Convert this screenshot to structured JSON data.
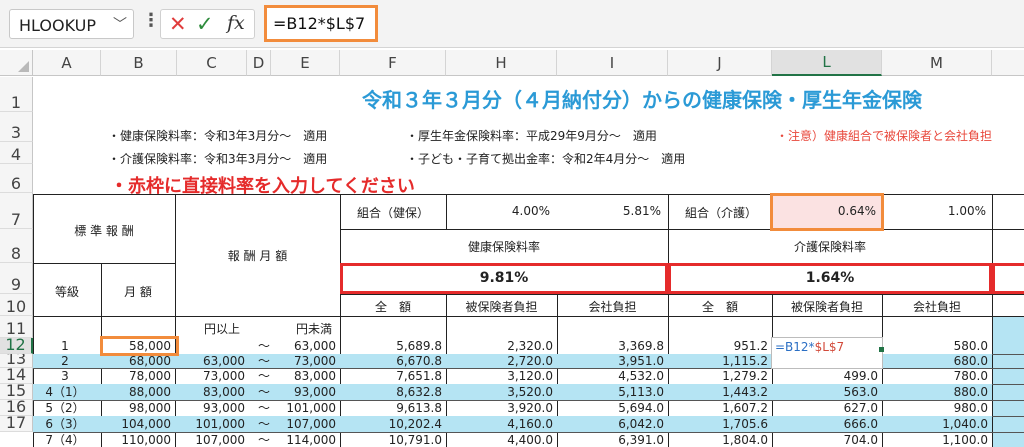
{
  "formula_bar": {
    "name_box": "HLOOKUP",
    "formula": "=B12*$L$7",
    "icons": [
      "chevron-down-icon",
      "more-vert-icon",
      "cancel-icon",
      "enter-icon",
      "fx-icon"
    ]
  },
  "columns": [
    "A",
    "B",
    "C",
    "D",
    "E",
    "F",
    "H",
    "I",
    "J",
    "L",
    "M"
  ],
  "rows": [
    "1",
    "3",
    "4",
    "6",
    "7",
    "8",
    "9",
    "10",
    "11",
    "12",
    "13",
    "14",
    "15",
    "16",
    "17"
  ],
  "sheet": {
    "title": "令和３年３月分（４月納付分）からの健康保険・厚生年金保険",
    "note1": "・健康保険料率：令和3年3月分～　適用",
    "note2": "・厚生年金保険料率：平成29年9月分～　適用",
    "note3": "・注意）健康組合で被保険者と会社負担",
    "note4": "・介護保険料率：令和3年3月分～　適用",
    "note5": "・子ども・子育て拠出金率：令和2年4月分～　適用",
    "instruction": "・赤枠に直接料率を入力してください",
    "hdr_standard": "標 準 報 酬",
    "hdr_grade": "等級",
    "hdr_month": "月 額",
    "hdr_range": "報 酬 月 額",
    "hdr_kumiai_ken": "組合（健保）",
    "kumiai_ken_rate": "4.00%",
    "kumiai_ken_rate2": "5.81%",
    "hdr_kumiai_kaigo": "組合（介護）",
    "kumiai_kaigo_rate": "0.64%",
    "kumiai_kaigo_rate2": "1.00%",
    "hdr_health_rate": "健康保険料率",
    "hdr_care_rate": "介護保険料率",
    "health_rate": "9.81%",
    "care_rate": "1.64%",
    "hdr_total": "全　額",
    "hdr_insured": "被保険者負担",
    "hdr_company": "会社負担",
    "hdr_total2": "全　額",
    "hdr_insured2": "被保険者負担",
    "hdr_company2": "会社負担",
    "from_label": "円以上",
    "to_label": "円未満",
    "edit_formula_ref1": "=B12*",
    "edit_formula_ref2": "$L$7"
  },
  "data_rows": [
    {
      "grade": "1",
      "monthly": "58,000",
      "from": "",
      "tilde": "～",
      "to": "63,000",
      "f": "5,689.8",
      "h": "2,320.0",
      "i": "3,369.8",
      "j": "951.2",
      "l": "",
      "m": "580.0",
      "cyan": false
    },
    {
      "grade": "2",
      "monthly": "68,000",
      "from": "63,000",
      "tilde": "～",
      "to": "73,000",
      "f": "6,670.8",
      "h": "2,720.0",
      "i": "3,951.0",
      "j": "1,115.2",
      "l": "",
      "m": "680.0",
      "cyan": true
    },
    {
      "grade": "3",
      "monthly": "78,000",
      "from": "73,000",
      "tilde": "～",
      "to": "83,000",
      "f": "7,651.8",
      "h": "3,120.0",
      "i": "4,532.0",
      "j": "1,279.2",
      "l": "499.0",
      "m": "780.0",
      "cyan": false
    },
    {
      "grade": "4（1）",
      "monthly": "88,000",
      "from": "83,000",
      "tilde": "～",
      "to": "93,000",
      "f": "8,632.8",
      "h": "3,520.0",
      "i": "5,113.0",
      "j": "1,443.2",
      "l": "563.0",
      "m": "880.0",
      "cyan": true
    },
    {
      "grade": "5（2）",
      "monthly": "98,000",
      "from": "93,000",
      "tilde": "～",
      "to": "101,000",
      "f": "9,613.8",
      "h": "3,920.0",
      "i": "5,694.0",
      "j": "1,607.2",
      "l": "627.0",
      "m": "980.0",
      "cyan": false
    },
    {
      "grade": "6（3）",
      "monthly": "104,000",
      "from": "101,000",
      "tilde": "～",
      "to": "107,000",
      "f": "10,202.4",
      "h": "4,160.0",
      "i": "6,042.0",
      "j": "1,705.6",
      "l": "666.0",
      "m": "1,040.0",
      "cyan": true
    },
    {
      "grade": "7（4）",
      "monthly": "110,000",
      "from": "107,000",
      "tilde": "～",
      "to": "114,000",
      "f": "10,791.0",
      "h": "4,400.0",
      "i": "6,391.0",
      "j": "1,804.0",
      "l": "704.0",
      "m": "1,100.0",
      "cyan": false
    }
  ]
}
